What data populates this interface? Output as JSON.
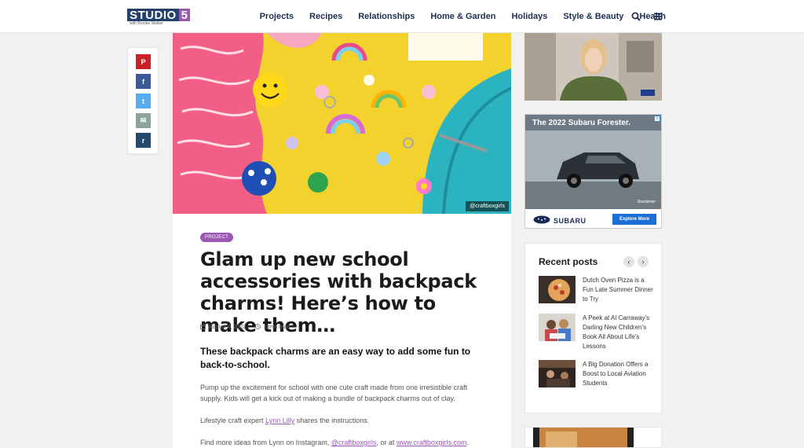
{
  "header": {
    "logo_main": "STUDIO",
    "logo_num": "5",
    "logo_sub": "with Brooke Walker",
    "nav": [
      "Projects",
      "Recipes",
      "Relationships",
      "Home & Garden",
      "Holidays",
      "Style & Beauty",
      "Health"
    ],
    "icons": [
      "search-icon",
      "menu-icon"
    ]
  },
  "share": {
    "buttons": [
      {
        "name": "pinterest",
        "glyph": "P",
        "color": "#cb2027"
      },
      {
        "name": "facebook",
        "glyph": "f",
        "color": "#3b5998"
      },
      {
        "name": "twitter",
        "glyph": "t",
        "color": "#55acee"
      },
      {
        "name": "email",
        "glyph": "✉",
        "color": "#8fa39e"
      },
      {
        "name": "reddit",
        "glyph": "r",
        "color": "#24496f"
      }
    ]
  },
  "article": {
    "photo_credit": "@craftboxgirls",
    "badge": "PROJECT",
    "title": "Glam up new school accessories with backpack charms! Here’s how to make them…",
    "date": "August 4, 2022",
    "read_time": "1 min read",
    "lead": "These backpack charms are an easy way to add some fun to back-to-school.",
    "para1": "Pump up the excitement for school with one cute craft made from one irresistible craft supply. Kids will get a kick out of making a bundle of backpack charms out of clay.",
    "para2_before": "Lifestyle craft expert ",
    "para2_link": "Lynn Lilly",
    "para2_after": " shares the instructions.",
    "para3_before": "Find more ideas from Lynn on Instagram, ",
    "para3_link1": "@craftboxgirls",
    "para3_mid": ", or at ",
    "para3_link2": "www.craftboxgirls.com",
    "para3_after": "."
  },
  "ad": {
    "headline": "The 2022 Subaru Forester.",
    "disclaimer": "Disclaimer",
    "brand": "SUBARU",
    "cta": "Explore More"
  },
  "recent": {
    "title": "Recent posts",
    "posts": [
      {
        "title": "Dutch Oven Pizza is a Fun Late Summer Dinner to Try"
      },
      {
        "title": "A Peek at Al Carraway's Darling New Children's Book All About Life's Lessons"
      },
      {
        "title": "A Big Donation Offers a Boost to Local Aviation Students"
      }
    ]
  },
  "colors": {
    "accent": "#9b59b6",
    "nav_text": "#1f2f4f",
    "background": "#f1f1f1"
  }
}
